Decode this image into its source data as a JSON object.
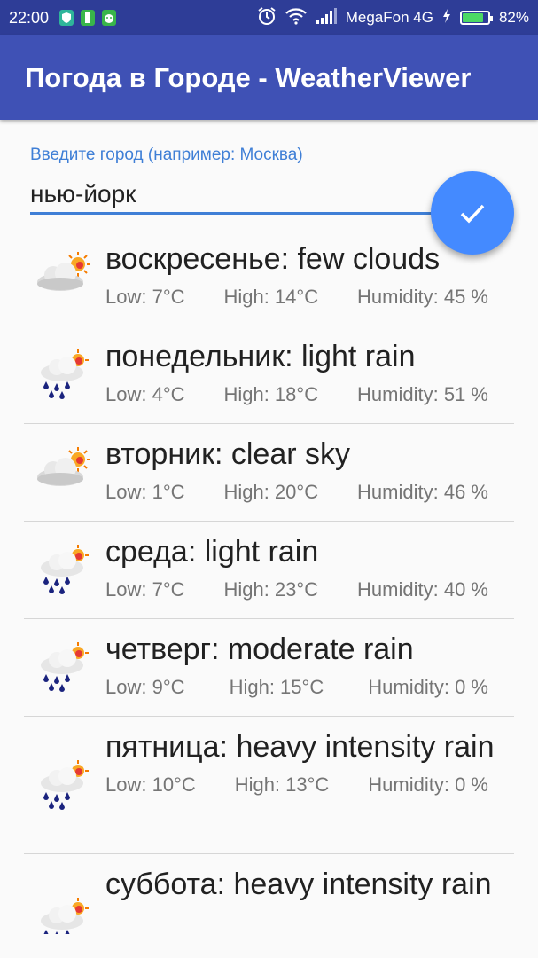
{
  "status_bar": {
    "time": "22:00",
    "carrier": "MegaFon 4G",
    "battery": "82%",
    "battery_level": 0.82
  },
  "app": {
    "title": "Погода в Городе - WeatherViewer"
  },
  "search": {
    "label": "Введите город (например: Москва)",
    "value": "нью-йорк"
  },
  "forecast": [
    {
      "description": "воскресенье: few clouds",
      "low": "Low: 7°C",
      "high": "High: 14°C",
      "humidity": "Humidity: 45 %",
      "icon": "cloud-sun-icon"
    },
    {
      "description": "понедельник: light rain",
      "low": "Low: 4°C",
      "high": "High: 18°C",
      "humidity": "Humidity: 51 %",
      "icon": "rain-sun-icon"
    },
    {
      "description": "вторник: clear sky",
      "low": "Low: 1°C",
      "high": "High: 20°C",
      "humidity": "Humidity: 46 %",
      "icon": "cloud-sun-icon"
    },
    {
      "description": "среда: light rain",
      "low": "Low: 7°C",
      "high": "High: 23°C",
      "humidity": "Humidity: 40 %",
      "icon": "rain-sun-icon"
    },
    {
      "description": "четверг: moderate rain",
      "low": "Low: 9°C",
      "high": "High: 15°C",
      "humidity": "Humidity: 0 %",
      "icon": "rain-sun-icon"
    },
    {
      "description": "пятница: heavy intensity rain",
      "low": "Low: 10°C",
      "high": "High: 13°C",
      "humidity": "Humidity: 0 %",
      "icon": "rain-sun-icon"
    },
    {
      "description": "суббота: heavy intensity rain",
      "low": "",
      "high": "",
      "humidity": "",
      "icon": "rain-sun-icon"
    }
  ]
}
